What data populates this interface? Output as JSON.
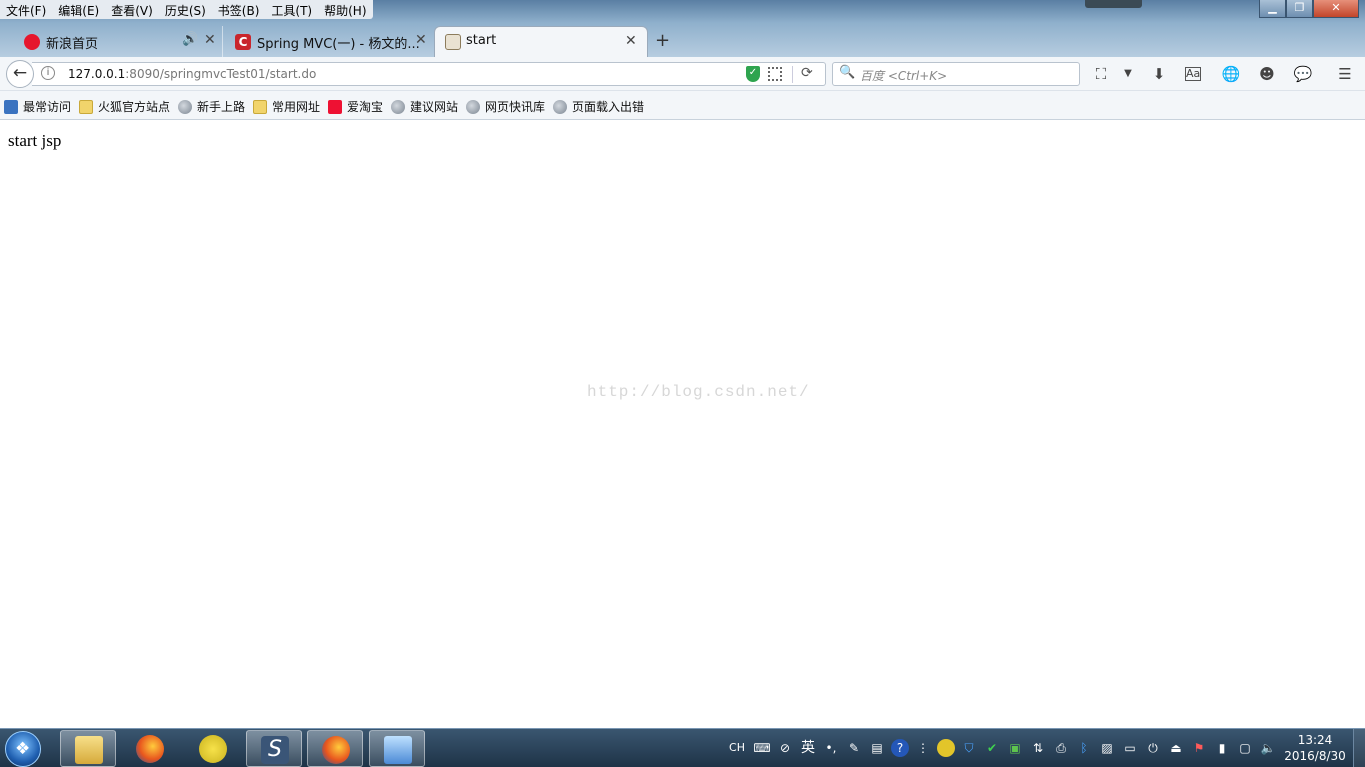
{
  "menubar": {
    "items": [
      "文件(F)",
      "编辑(E)",
      "查看(V)",
      "历史(S)",
      "书签(B)",
      "工具(T)",
      "帮助(H)"
    ]
  },
  "tabs": [
    {
      "label": "新浪首页",
      "favicon": "weibo-icon",
      "favicon_color": "#e6162d"
    },
    {
      "label": "Spring MVC(一) - 杨文的...",
      "favicon": "csdn-icon",
      "favicon_color": "#c9252c"
    },
    {
      "label": "start",
      "favicon": "page-icon",
      "favicon_color": "#c8a66e"
    }
  ],
  "navbar": {
    "url_host": "127.0.0.1",
    "url_rest": ":8090/springmvcTest01/start.do",
    "search_placeholder": "百度 <Ctrl+K>"
  },
  "bookmarks": [
    {
      "label": "最常访问",
      "icon": "star-icon"
    },
    {
      "label": "火狐官方站点",
      "icon": "folder-icon"
    },
    {
      "label": "新手上路",
      "icon": "globe-icon"
    },
    {
      "label": "常用网址",
      "icon": "folder-icon"
    },
    {
      "label": "爱淘宝",
      "icon": "taobao-icon"
    },
    {
      "label": "建议网站",
      "icon": "globe-icon"
    },
    {
      "label": "网页快讯库",
      "icon": "globe-icon"
    },
    {
      "label": "页面载入出错",
      "icon": "globe-icon"
    }
  ],
  "content": {
    "text": "start jsp",
    "watermark": "http://blog.csdn.net/"
  },
  "taskbar": {
    "tray_lang": "CH",
    "tray_ime": "英",
    "time": "13:24",
    "date": "2016/8/30"
  }
}
